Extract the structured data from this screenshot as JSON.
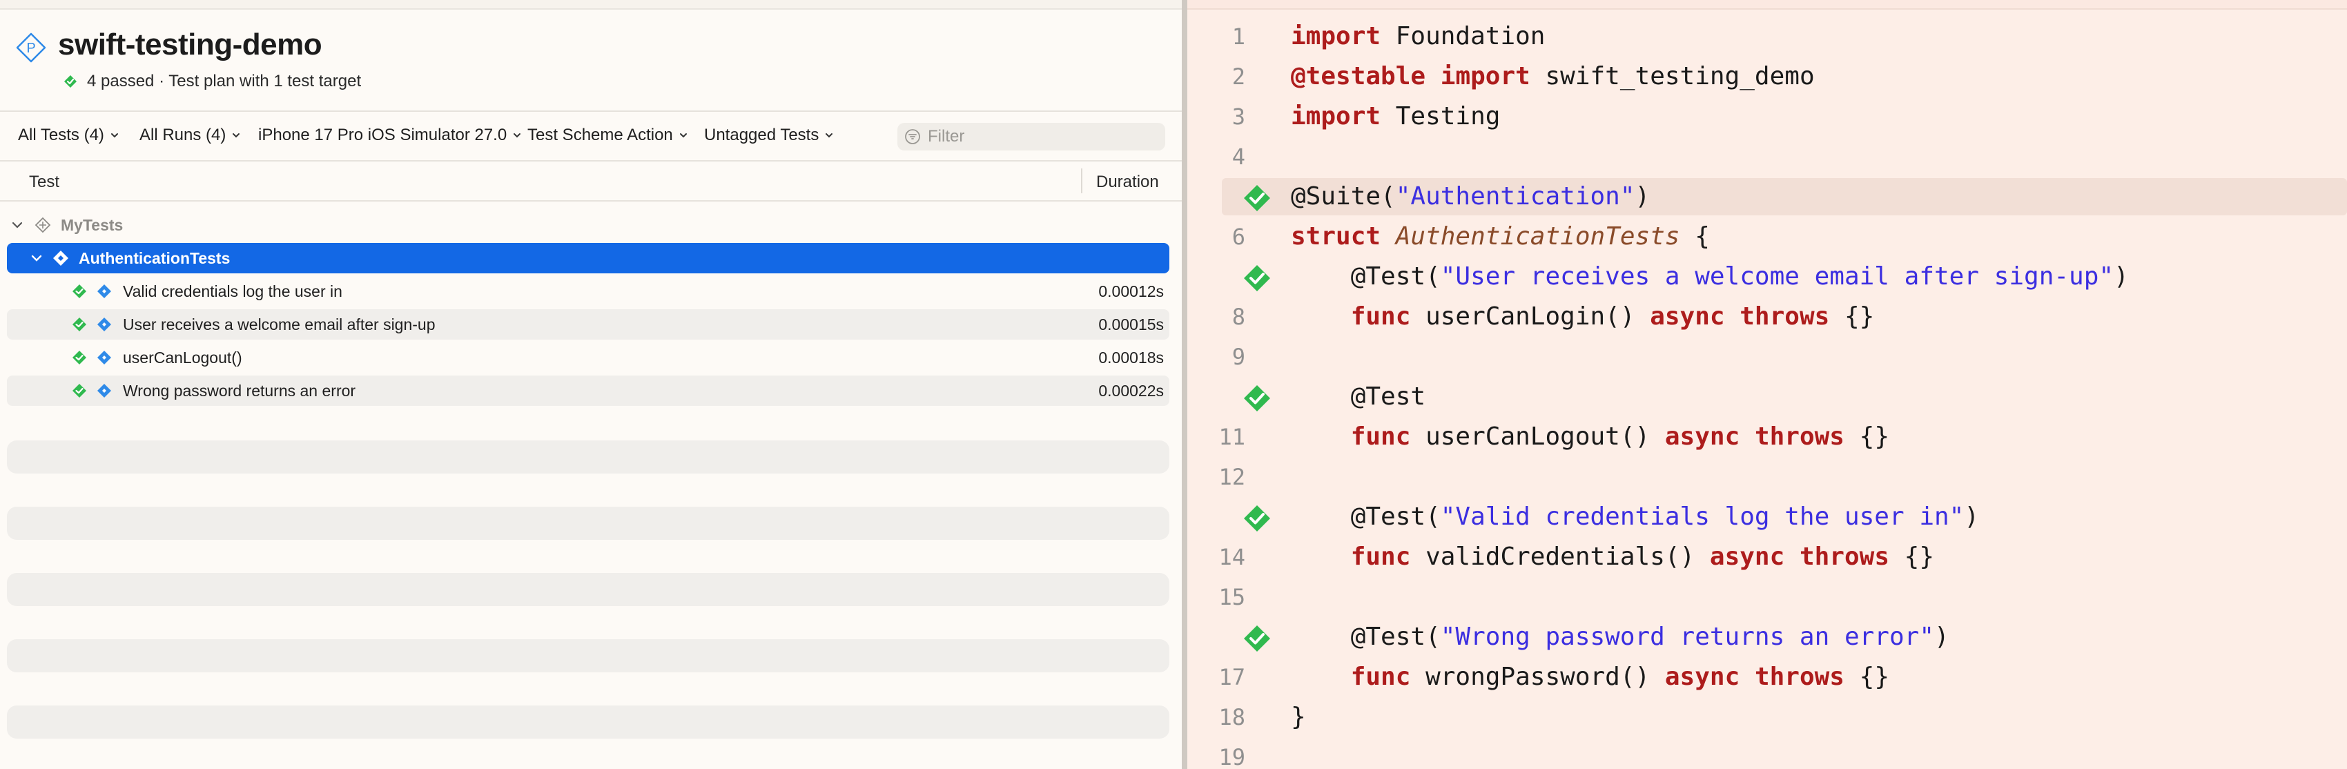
{
  "left": {
    "title": "swift-testing-demo",
    "summary": "4 passed · Test plan with 1 test target",
    "toolbar": {
      "all_tests": "All Tests (4)",
      "all_runs": "All Runs (4)",
      "device": "iPhone 17 Pro iOS Simulator 27.0",
      "scheme_action": "Test Scheme Action",
      "tags": "Untagged Tests",
      "filter_placeholder": "Filter"
    },
    "columns": {
      "test": "Test",
      "duration": "Duration"
    },
    "group": "MyTests",
    "suite": "AuthenticationTests",
    "tests": [
      {
        "name": "Valid credentials log the user in",
        "duration": "0.00012s",
        "status": "passed"
      },
      {
        "name": "User receives a welcome email after sign-up",
        "duration": "0.00015s",
        "status": "passed"
      },
      {
        "name": "userCanLogout()",
        "duration": "0.00018s",
        "status": "passed"
      },
      {
        "name": "Wrong password returns an error",
        "duration": "0.00022s",
        "status": "passed"
      }
    ]
  },
  "colors": {
    "pass_green": "#30b94f",
    "selection_blue": "#1368e5",
    "keyword": "#ad1c1c",
    "string": "#3b2ee0",
    "type": "#8a4b2a"
  },
  "editor": {
    "lines": [
      {
        "n": "1",
        "pass": false,
        "tokens": [
          [
            "kw",
            "import"
          ],
          [
            "p",
            " Foundation"
          ]
        ]
      },
      {
        "n": "2",
        "pass": false,
        "tokens": [
          [
            "kw",
            "@testable"
          ],
          [
            "p",
            " "
          ],
          [
            "kw",
            "import"
          ],
          [
            "p",
            " swift_testing_demo"
          ]
        ]
      },
      {
        "n": "3",
        "pass": false,
        "tokens": [
          [
            "kw",
            "import"
          ],
          [
            "p",
            " Testing"
          ]
        ]
      },
      {
        "n": "4",
        "pass": false,
        "tokens": []
      },
      {
        "n": "",
        "pass": true,
        "highlight": true,
        "tokens": [
          [
            "p",
            "@Suite("
          ],
          [
            "str",
            "\"Authentication\""
          ],
          [
            "p",
            ")"
          ]
        ]
      },
      {
        "n": "6",
        "pass": false,
        "tokens": [
          [
            "kw",
            "struct"
          ],
          [
            "p",
            " "
          ],
          [
            "typ",
            "AuthenticationTests"
          ],
          [
            "p",
            " {"
          ]
        ]
      },
      {
        "n": "",
        "pass": true,
        "tokens": [
          [
            "p",
            "    @Test("
          ],
          [
            "str",
            "\"User receives a welcome email after sign-up\""
          ],
          [
            "p",
            ")"
          ]
        ]
      },
      {
        "n": "8",
        "pass": false,
        "tokens": [
          [
            "p",
            "    "
          ],
          [
            "kw",
            "func"
          ],
          [
            "p",
            " userCanLogin() "
          ],
          [
            "kw",
            "async"
          ],
          [
            "p",
            " "
          ],
          [
            "kw",
            "throws"
          ],
          [
            "p",
            " {}"
          ]
        ]
      },
      {
        "n": "9",
        "pass": false,
        "tokens": []
      },
      {
        "n": "",
        "pass": true,
        "tokens": [
          [
            "p",
            "    @Test"
          ]
        ]
      },
      {
        "n": "11",
        "pass": false,
        "tokens": [
          [
            "p",
            "    "
          ],
          [
            "kw",
            "func"
          ],
          [
            "p",
            " userCanLogout() "
          ],
          [
            "kw",
            "async"
          ],
          [
            "p",
            " "
          ],
          [
            "kw",
            "throws"
          ],
          [
            "p",
            " {}"
          ]
        ]
      },
      {
        "n": "12",
        "pass": false,
        "tokens": []
      },
      {
        "n": "",
        "pass": true,
        "tokens": [
          [
            "p",
            "    @Test("
          ],
          [
            "str",
            "\"Valid credentials log the user in\""
          ],
          [
            "p",
            ")"
          ]
        ]
      },
      {
        "n": "14",
        "pass": false,
        "tokens": [
          [
            "p",
            "    "
          ],
          [
            "kw",
            "func"
          ],
          [
            "p",
            " validCredentials() "
          ],
          [
            "kw",
            "async"
          ],
          [
            "p",
            " "
          ],
          [
            "kw",
            "throws"
          ],
          [
            "p",
            " {}"
          ]
        ]
      },
      {
        "n": "15",
        "pass": false,
        "tokens": []
      },
      {
        "n": "",
        "pass": true,
        "tokens": [
          [
            "p",
            "    @Test("
          ],
          [
            "str",
            "\"Wrong password returns an error\""
          ],
          [
            "p",
            ")"
          ]
        ]
      },
      {
        "n": "17",
        "pass": false,
        "tokens": [
          [
            "p",
            "    "
          ],
          [
            "kw",
            "func"
          ],
          [
            "p",
            " wrongPassword() "
          ],
          [
            "kw",
            "async"
          ],
          [
            "p",
            " "
          ],
          [
            "kw",
            "throws"
          ],
          [
            "p",
            " {}"
          ]
        ]
      },
      {
        "n": "18",
        "pass": false,
        "tokens": [
          [
            "p",
            "}"
          ]
        ]
      },
      {
        "n": "19",
        "pass": false,
        "tokens": []
      }
    ]
  }
}
